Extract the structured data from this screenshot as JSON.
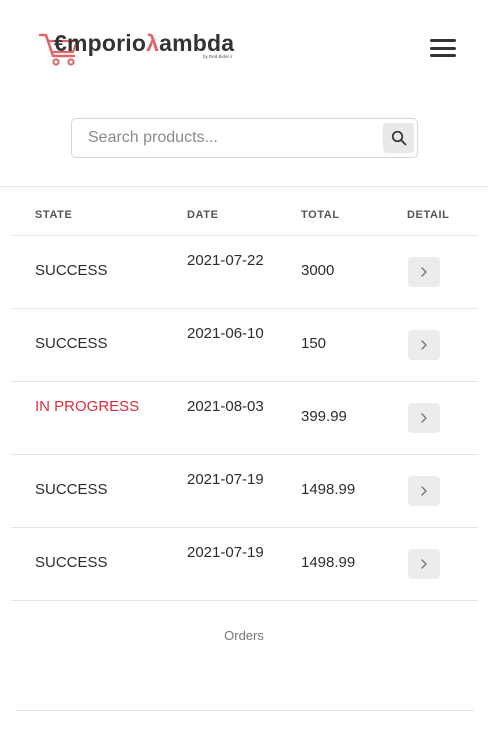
{
  "brand": {
    "prefix": "€mporio",
    "lambda": "λ",
    "suffix": "ambda",
    "tagline": "by Red Bidet λ",
    "accent_color": "#e06666"
  },
  "header": {
    "menu_icon": "hamburger-menu-icon"
  },
  "search": {
    "placeholder": "Search products...",
    "value": "",
    "icon": "search-icon"
  },
  "table": {
    "columns": [
      "STATE",
      "DATE",
      "TOTAL",
      "DETAIL"
    ],
    "rows": [
      {
        "state": "SUCCESS",
        "date": "2021-07-22",
        "total": "3000",
        "detail_icon": "chevron-right-icon"
      },
      {
        "state": "SUCCESS",
        "date": "2021-06-10",
        "total": "150",
        "detail_icon": "chevron-right-icon"
      },
      {
        "state": "IN PROGRESS",
        "date": "2021-08-03",
        "total": "399.99",
        "detail_icon": "chevron-right-icon"
      },
      {
        "state": "SUCCESS",
        "date": "2021-07-19",
        "total": "1498.99",
        "detail_icon": "chevron-right-icon"
      },
      {
        "state": "SUCCESS",
        "date": "2021-07-19",
        "total": "1498.99",
        "detail_icon": "chevron-right-icon"
      }
    ],
    "caption": "Orders",
    "in_progress_color": "#e02d3c"
  }
}
